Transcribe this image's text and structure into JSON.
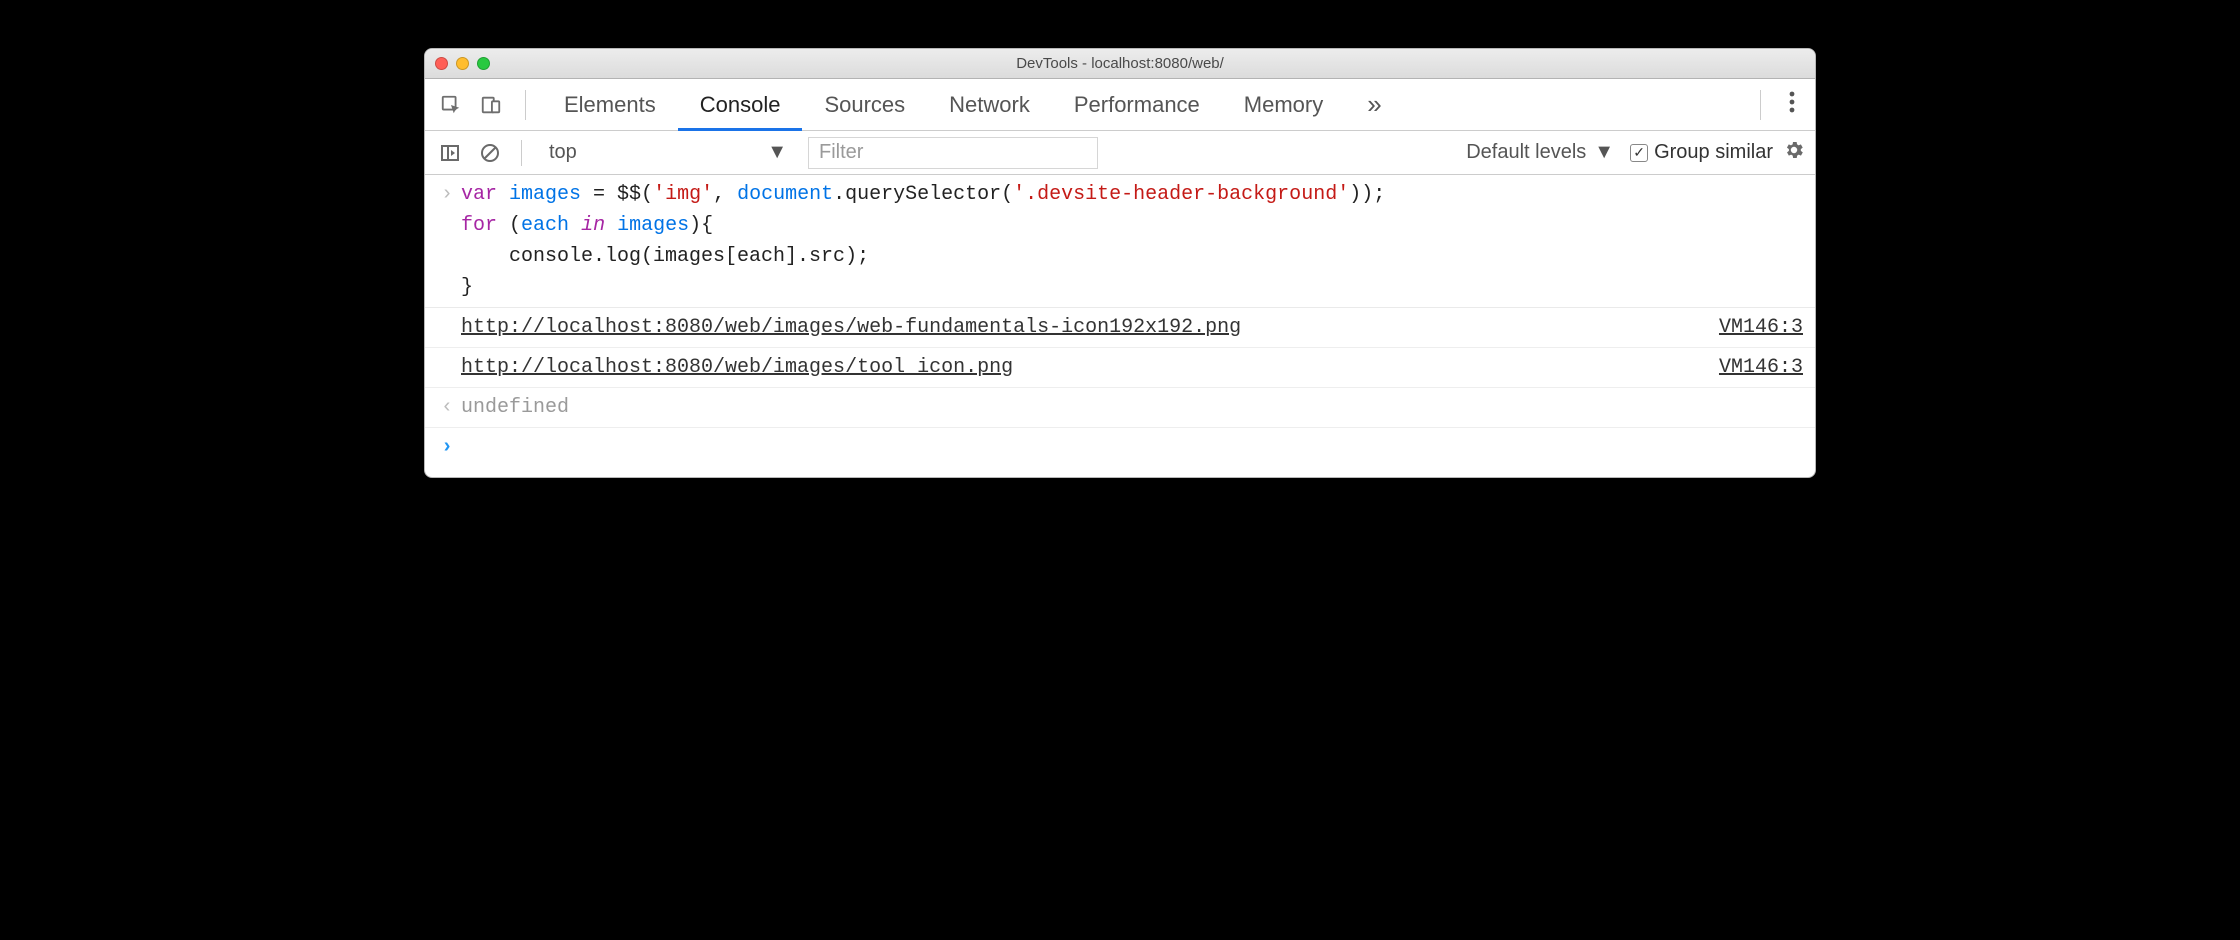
{
  "window": {
    "title": "DevTools - localhost:8080/web/"
  },
  "tabs": {
    "items": [
      "Elements",
      "Console",
      "Sources",
      "Network",
      "Performance",
      "Memory"
    ],
    "active_index": 1,
    "overflow_glyph": "»"
  },
  "filter": {
    "context_label": "top",
    "filter_placeholder": "Filter",
    "levels_label": "Default levels",
    "group_similar_label": "Group similar",
    "group_similar_checked": true
  },
  "code": {
    "t1": "var",
    "t2": " ",
    "t3": "images",
    "t4": " = $$(",
    "t5": "'img'",
    "t6": ", ",
    "t7": "document",
    "t8": ".querySelector(",
    "t9": "'.devsite-header-background'",
    "t10": "));",
    "l2a": "for",
    "l2b": " (",
    "l2c": "each",
    "l2d": " ",
    "l2e": "in",
    "l2f": " ",
    "l2g": "images",
    "l2h": "){",
    "l3": "    console.log(images[each].src);",
    "l4": "}"
  },
  "logs": [
    {
      "text": "http://localhost:8080/web/images/web-fundamentals-icon192x192.png",
      "source": "VM146:3"
    },
    {
      "text": "http://localhost:8080/web/images/tool_icon.png",
      "source": "VM146:3"
    }
  ],
  "result": "undefined",
  "prompt_cursor": ""
}
